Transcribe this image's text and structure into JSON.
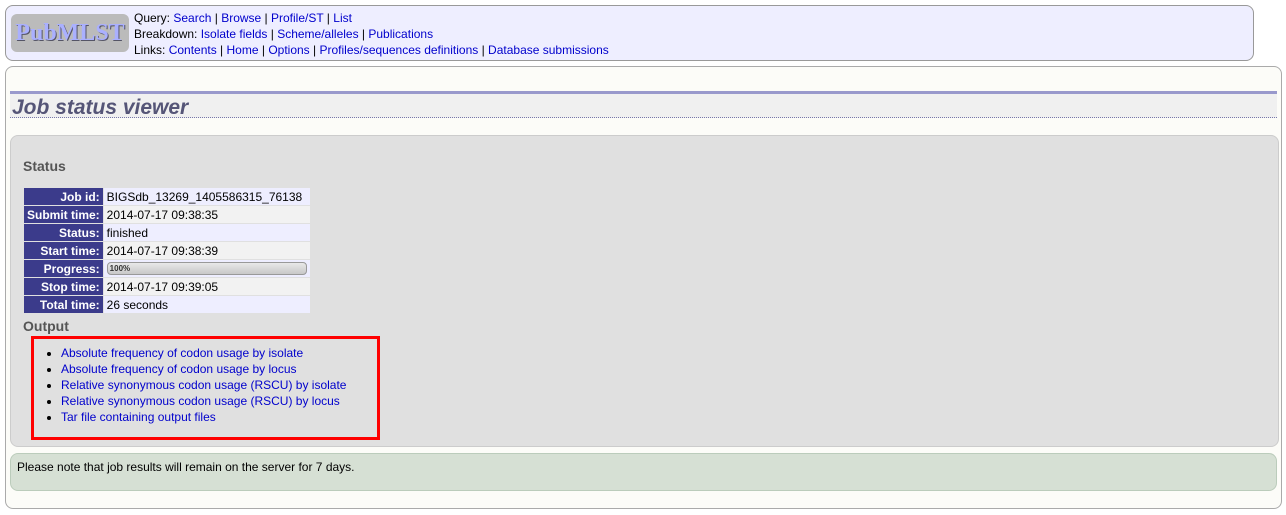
{
  "header": {
    "logo": "PubMLST",
    "query_label": "Query:",
    "query": [
      "Search",
      "Browse",
      "Profile/ST",
      "List"
    ],
    "breakdown_label": "Breakdown:",
    "breakdown": [
      "Isolate fields",
      "Scheme/alleles",
      "Publications"
    ],
    "links_label": "Links:",
    "links": [
      "Contents",
      "Home",
      "Options",
      "Profiles/sequences definitions",
      "Database submissions"
    ]
  },
  "page_title": "Job status viewer",
  "status": {
    "heading": "Status",
    "rows": [
      {
        "label": "Job id:",
        "value": "BIGSdb_13269_1405586315_76138"
      },
      {
        "label": "Submit time:",
        "value": "2014-07-17 09:38:35"
      },
      {
        "label": "Status:",
        "value": "finished"
      },
      {
        "label": "Start time:",
        "value": "2014-07-17 09:38:39"
      },
      {
        "label": "Progress:",
        "value": "100%",
        "progress_percent": 100
      },
      {
        "label": "Stop time:",
        "value": "2014-07-17 09:39:05"
      },
      {
        "label": "Total time:",
        "value": "26 seconds"
      }
    ]
  },
  "output": {
    "heading": "Output",
    "items": [
      "Absolute frequency of codon usage by isolate",
      "Absolute frequency of codon usage by locus",
      "Relative synonymous codon usage (RSCU) by isolate",
      "Relative synonymous codon usage (RSCU) by locus",
      "Tar file containing output files"
    ]
  },
  "note": "Please note that job results will remain on the server for 7 days.",
  "colors": {
    "highlight": "#ff0000",
    "table_header": "#3b3b8b",
    "link": "#0000cc"
  }
}
